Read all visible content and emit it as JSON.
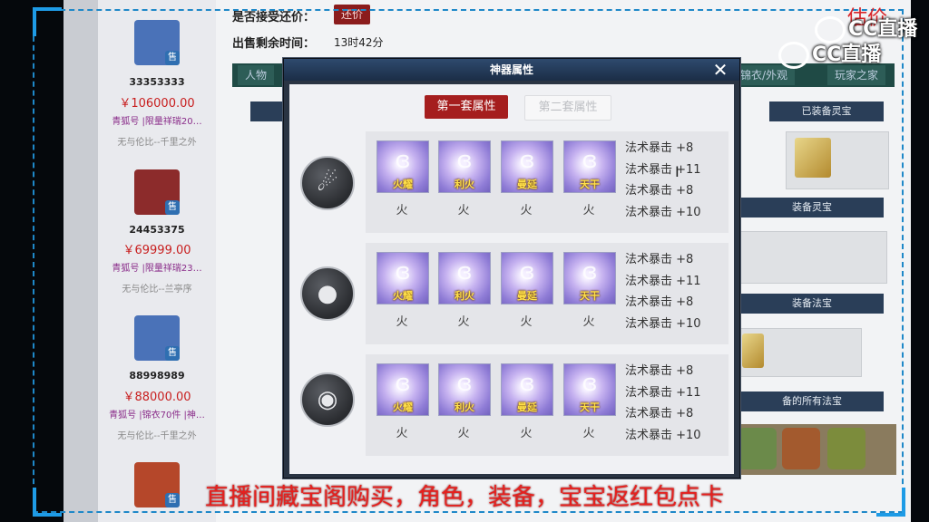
{
  "page": {
    "bargain_label": "是否接受还价：",
    "bargain_button": "还价",
    "remaining_label": "出售剩余时间：",
    "remaining_value": "13时42分",
    "tabs": [
      "人物",
      "锦衣/外观",
      "玩家之家"
    ],
    "subheads": [
      "已装备灵宝",
      "装备灵宝",
      "装备法宝",
      "备的所有法宝"
    ]
  },
  "listings": [
    {
      "id": "33353333",
      "price": "￥106000.00",
      "tags": "青狐号 |限量祥瑞20…",
      "server": "无与伦比--千里之外",
      "sell": "售",
      "avatar_color": "#4a72b8"
    },
    {
      "id": "24453375",
      "price": "￥69999.00",
      "tags": "青狐号 |限量祥瑞23…",
      "server": "无与伦比--兰亭序",
      "sell": "售",
      "avatar_color": "#8c2b2b"
    },
    {
      "id": "88998989",
      "price": "￥88000.00",
      "tags": "青狐号 |锦衣70件 |神…",
      "server": "无与伦比--千里之外",
      "sell": "售",
      "avatar_color": "#4a72b8"
    },
    {
      "sell": "售",
      "avatar_color": "#b5472a"
    }
  ],
  "modal": {
    "title": "神器属性",
    "close": "✕",
    "tab_active": "第一套属性",
    "tab_inactive": "第二套属性",
    "rows": [
      {
        "emblem": "☄",
        "orbs": [
          {
            "name": "火耀",
            "element": "火"
          },
          {
            "name": "利火",
            "element": "火"
          },
          {
            "name": "曼延",
            "element": "火"
          },
          {
            "name": "天干",
            "element": "火"
          }
        ],
        "attrs": [
          "法术暴击 +8",
          "法术暴击 +11",
          "法术暴击 +8",
          "法术暴击 +10"
        ]
      },
      {
        "emblem": "●",
        "orbs": [
          {
            "name": "火耀",
            "element": "火"
          },
          {
            "name": "利火",
            "element": "火"
          },
          {
            "name": "曼延",
            "element": "火"
          },
          {
            "name": "天干",
            "element": "火"
          }
        ],
        "attrs": [
          "法术暴击 +8",
          "法术暴击 +11",
          "法术暴击 +8",
          "法术暴击 +10"
        ]
      },
      {
        "emblem": "◉",
        "orbs": [
          {
            "name": "火耀",
            "element": "火"
          },
          {
            "name": "利火",
            "element": "火"
          },
          {
            "name": "曼延",
            "element": "火"
          },
          {
            "name": "天干",
            "element": "火"
          }
        ],
        "attrs": [
          "法术暴击 +8",
          "法术暴击 +11",
          "法术暴击 +8",
          "法术暴击 +10"
        ]
      }
    ]
  },
  "overlay": {
    "banner": "直播间藏宝阁购买，角色，装备，宝宝返红包点卡",
    "logo": "CC直播",
    "corner_price": "估价"
  },
  "colors": {
    "accent_red": "#a51e1e",
    "price_red": "#c81e1e",
    "modal_header": "#1b2d46",
    "orb_name": "#ffe04a",
    "frame_blue": "#1e9be6"
  }
}
